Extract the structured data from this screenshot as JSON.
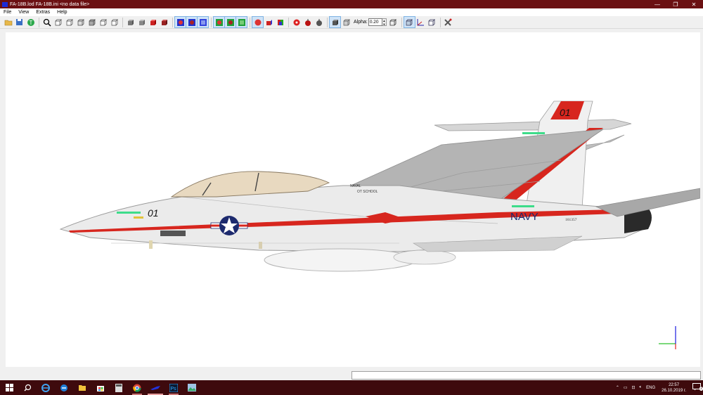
{
  "window": {
    "title": "FA-18B.lod  FA-18B.ini  <no data file>"
  },
  "menu": [
    "File",
    "View",
    "Extras",
    "Help"
  ],
  "toolbar": {
    "alpha_label": "Alpha:",
    "alpha_value": "0.20"
  },
  "aircraft": {
    "nose_number": "01",
    "tail_number": "01",
    "service_text": "NAVY",
    "serial_text": "161357",
    "canopy_text_1": "NAVAL",
    "canopy_text_2": "OT SCHOOL",
    "colors": {
      "stripe": "#d7261e",
      "body": "#e9e9e9",
      "wing": "#b4b4b4",
      "canopy": "#e8d9c0"
    }
  },
  "axes_gizmo": {
    "x_color": "#2cc22c",
    "y_color": "#1a1ae0",
    "z_color": "#e02020"
  },
  "taskbar": {
    "apps": [
      "start-icon",
      "search-icon",
      "ie-icon",
      "edge-icon",
      "explorer-icon",
      "store-icon",
      "calculator-icon",
      "chrome-icon",
      "lod-viewer-icon",
      "photoshop-icon",
      "photos-icon"
    ],
    "language": "ENG",
    "time": "22:57",
    "date": "26.10.2019 г.",
    "notifications": "2"
  }
}
